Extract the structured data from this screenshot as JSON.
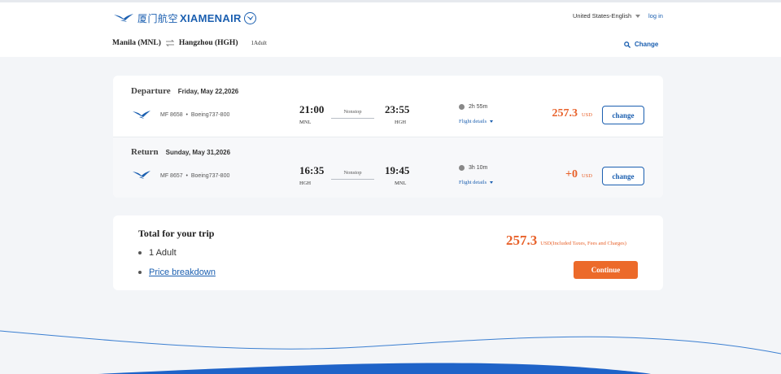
{
  "header": {
    "logo_cn": "厦门航空",
    "logo_en": "XIAMENAIR",
    "language": "United States-English",
    "login_label": "log in"
  },
  "route": {
    "origin": "Manila (MNL)",
    "destination": "Hangzhou (HGH)",
    "passengers": "1Adult",
    "change_label": "Change"
  },
  "departure": {
    "type": "Departure",
    "date": "Friday, May 22,2026",
    "flight_no": "MF 8658",
    "aircraft": "Boeing737-800",
    "dep_time": "21:00",
    "dep_code": "MNL",
    "stops": "Nonstop",
    "arr_time": "23:55",
    "arr_code": "HGH",
    "duration": "2h 55m",
    "details_label": "Flight details",
    "price": "257.3",
    "currency": "USD",
    "change_label": "change"
  },
  "return": {
    "type": "Return",
    "date": "Sunday, May 31,2026",
    "flight_no": "MF 8657",
    "aircraft": "Boeing737-800",
    "dep_time": "16:35",
    "dep_code": "HGH",
    "stops": "Nonstop",
    "arr_time": "19:45",
    "arr_code": "MNL",
    "duration": "3h 10m",
    "details_label": "Flight details",
    "price": "+0",
    "currency": "USD",
    "change_label": "change"
  },
  "total": {
    "title": "Total for your trip",
    "adults": "1 Adult",
    "breakdown_label": "Price breakdown",
    "price": "257.3",
    "price_note": "USD(Included Taxes, Fees and Charges)",
    "continue_label": "Continue"
  },
  "colors": {
    "brand_blue": "#1b5fb0",
    "price_orange": "#e8622b",
    "continue_orange": "#ec6a2a",
    "page_bg": "#f3f5f8"
  },
  "icons": {
    "logo": "egret-logo-icon",
    "swap": "swap-arrows-icon",
    "search": "search-icon",
    "airline": "egret-airline-icon",
    "clock": "clock-icon",
    "dropdown": "caret-down-icon"
  }
}
